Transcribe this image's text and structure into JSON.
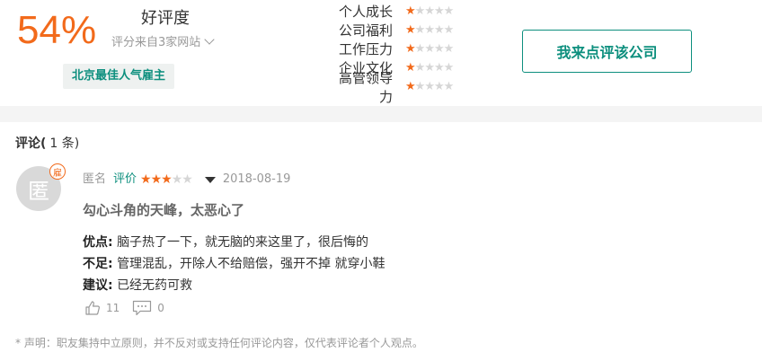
{
  "rating": {
    "percent": "54%",
    "percent_label": "好评度",
    "source": "评分来自3家网站",
    "badge": "北京最佳人气雇主"
  },
  "dimensions": [
    {
      "label": "个人成长",
      "stars": 1,
      "max": 5
    },
    {
      "label": "公司福利",
      "stars": 1,
      "max": 5
    },
    {
      "label": "工作压力",
      "stars": 1,
      "max": 5
    },
    {
      "label": "企业文化",
      "stars": 1,
      "max": 5
    },
    {
      "label": "高管领导力",
      "stars": 1,
      "max": 5
    }
  ],
  "cta_label": "我来点评该公司",
  "comments": {
    "title": "评论(",
    "count": "1 条)",
    "item": {
      "avatar_char": "匿",
      "employee_tag": "雇",
      "author": "匿名",
      "rating_label": "评价",
      "stars": 3,
      "max": 5,
      "date": "2018-08-19",
      "headline": "勾心斗角的天峰，太恶心了",
      "pros_key": "优点:",
      "pros": "脑子热了一下，就无脑的来这里了，很后悔的",
      "cons_key": "不足:",
      "cons": "管理混乱，开除人不给赔偿，强开不掉 就穿小鞋",
      "advice_key": "建议:",
      "advice": "已经无药可救",
      "likes": "11",
      "replies": "0"
    },
    "disclaimer": "* 声明：职友集持中立原则，并不反对或支持任何评论内容，仅代表评论者个人观点。"
  },
  "colors": {
    "accent_orange": "#f26a1b",
    "accent_green": "#0d8f7e",
    "star_off": "#d6d6d6"
  },
  "icons": [
    "chevron-down-icon",
    "star-icon",
    "caret-down-icon",
    "thumbs-up-icon",
    "comment-icon"
  ]
}
